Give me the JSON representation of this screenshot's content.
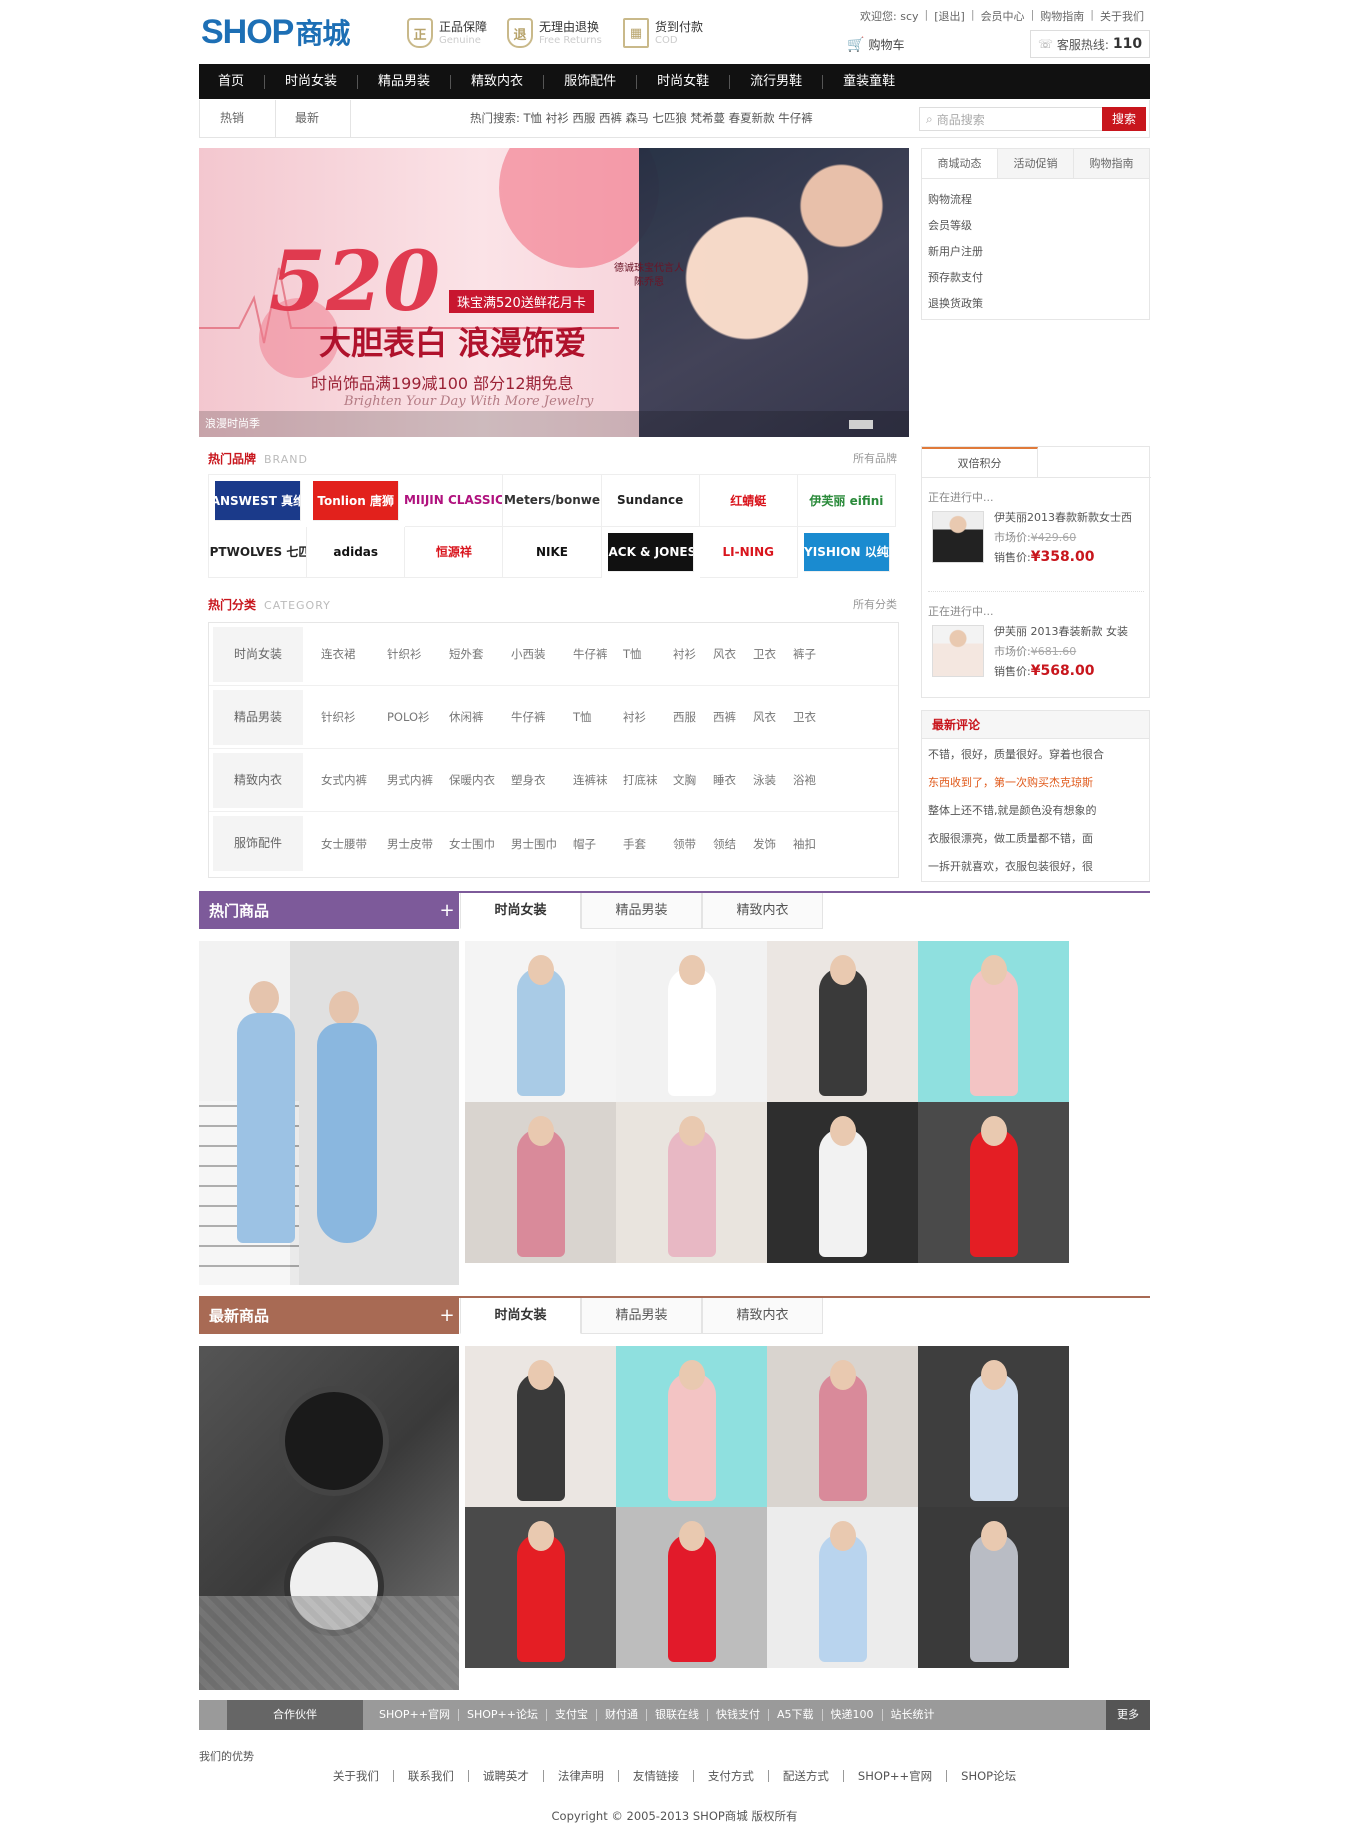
{
  "header": {
    "logo_en": "SHOP",
    "logo_cn": "商城",
    "badges": [
      {
        "title": "正品保障",
        "sub": "Genuine",
        "icon": "shield-icon"
      },
      {
        "title": "无理由退换",
        "sub": "Free Returns",
        "icon": "shield-icon"
      },
      {
        "title": "货到付款",
        "sub": "COD",
        "icon": "box-icon"
      }
    ],
    "welcome": "欢迎您: scy",
    "logout": "[退出]",
    "links": [
      "会员中心",
      "购物指南",
      "关于我们"
    ],
    "cart": "购物车",
    "hotline_label": "客服热线:",
    "hotline_num": "110"
  },
  "nav": [
    "首页",
    "时尚女装",
    "精品男装",
    "精致内衣",
    "服饰配件",
    "时尚女鞋",
    "流行男鞋",
    "童装童鞋"
  ],
  "subbar": {
    "tab_hot": "热销",
    "tab_new": "最新",
    "hot_keywords": "热门搜索: T恤 衬衫 西服 西裤 森马 七匹狼 梵希蔓 春夏新款 牛仔裤",
    "search_placeholder": "商品搜索",
    "search_button": "搜索"
  },
  "banner": {
    "num": "520",
    "tag": "珠宝满520送鲜花月卡",
    "main": "大胆表白 浪漫饰爱",
    "sub": "时尚饰品满199减100 部分12期免息",
    "slogan": "Brighten Your Day With More Jewelry",
    "brand": "德诚珠宝代言人\n陈乔恩",
    "caption": "浪漫时尚季"
  },
  "news": {
    "tabs": [
      "商城动态",
      "活动促销",
      "购物指南"
    ],
    "items": [
      "购物流程",
      "会员等级",
      "新用户注册",
      "预存款支付",
      "退换货政策"
    ]
  },
  "brands": {
    "title": "热门品牌",
    "en": "BRAND",
    "all": "所有品牌",
    "items": [
      {
        "name": "JEANSWEST 真维斯",
        "bg": "#1b3a8a",
        "fg": "#ffffff"
      },
      {
        "name": "Tonlion 唐狮",
        "bg": "#e2211c",
        "fg": "#ffffff"
      },
      {
        "name": "MIIJIN CLASSIC",
        "bg": "#ffffff",
        "fg": "#b0127e"
      },
      {
        "name": "Meters/bonwe",
        "bg": "#ffffff",
        "fg": "#333333"
      },
      {
        "name": "Sundance",
        "bg": "#ffffff",
        "fg": "#222222"
      },
      {
        "name": "红蜻蜓",
        "bg": "#ffffff",
        "fg": "#d9151d"
      },
      {
        "name": "伊芙丽 eifini",
        "bg": "#ffffff",
        "fg": "#2a8a3a"
      },
      {
        "name": "SEPTWOLVES 七匹狼",
        "bg": "#ffffff",
        "fg": "#222222"
      },
      {
        "name": "adidas",
        "bg": "#ffffff",
        "fg": "#111111"
      },
      {
        "name": "恒源祥",
        "bg": "#ffffff",
        "fg": "#d9151d"
      },
      {
        "name": "NIKE",
        "bg": "#ffffff",
        "fg": "#111111"
      },
      {
        "name": "JACK & JONES",
        "bg": "#111111",
        "fg": "#ffffff"
      },
      {
        "name": "LI-NING",
        "bg": "#ffffff",
        "fg": "#d9151d"
      },
      {
        "name": "YISHION 以纯",
        "bg": "#1a8bd0",
        "fg": "#ffffff"
      }
    ]
  },
  "category": {
    "title": "热门分类",
    "en": "CATEGORY",
    "all": "所有分类",
    "rows": [
      {
        "head": "时尚女装",
        "items": [
          "连衣裙",
          "针织衫",
          "短外套",
          "小西装",
          "牛仔裤",
          "T恤",
          "衬衫",
          "风衣",
          "卫衣",
          "裤子"
        ]
      },
      {
        "head": "精品男装",
        "items": [
          "针织衫",
          "POLO衫",
          "休闲裤",
          "牛仔裤",
          "T恤",
          "衬衫",
          "西服",
          "西裤",
          "风衣",
          "卫衣"
        ]
      },
      {
        "head": "精致内衣",
        "items": [
          "女式内裤",
          "男式内裤",
          "保暖内衣",
          "塑身衣",
          "连裤袜",
          "打底袜",
          "文胸",
          "睡衣",
          "泳装",
          "浴袍"
        ]
      },
      {
        "head": "服饰配件",
        "items": [
          "女士腰带",
          "男士皮带",
          "女士围巾",
          "男士围巾",
          "帽子",
          "手套",
          "领带",
          "领结",
          "发饰",
          "袖扣"
        ]
      }
    ]
  },
  "double_points": {
    "tab": "双倍积分",
    "items": [
      {
        "status": "正在进行中...",
        "name": "伊芙丽2013春款新款女士西",
        "market_label": "市场价:",
        "market": "¥429.60",
        "sale_label": "销售价:",
        "sale": "¥358.00"
      },
      {
        "status": "正在进行中...",
        "name": "伊芙丽 2013春装新款 女装",
        "market_label": "市场价:",
        "market": "¥681.60",
        "sale_label": "销售价:",
        "sale": "¥568.00"
      }
    ]
  },
  "reviews": {
    "title": "最新评论",
    "items": [
      {
        "text": "不错，很好，质量很好。穿着也很合",
        "hl": false
      },
      {
        "text": "东西收到了，第一次购买杰克琼斯",
        "hl": true
      },
      {
        "text": "整体上还不错,就是颜色没有想象的",
        "hl": false
      },
      {
        "text": "衣服很漂亮，做工质量都不错，面",
        "hl": false
      },
      {
        "text": "一拆开就喜欢，衣服包装很好，很",
        "hl": false
      }
    ]
  },
  "hot_products": {
    "title": "热门商品",
    "plus": "+",
    "color": "#7d5a9a",
    "tabs": [
      "时尚女装",
      "精品男装",
      "精致内衣"
    ]
  },
  "new_products": {
    "title": "最新商品",
    "plus": "+",
    "color": "#a86a54",
    "tabs": [
      "时尚女装",
      "精品男装",
      "精致内衣"
    ]
  },
  "footer": {
    "partner_label": "合作伙伴",
    "partners": [
      "SHOP++官网",
      "SHOP++论坛",
      "支付宝",
      "财付通",
      "银联在线",
      "快钱支付",
      "A5下载",
      "快递100",
      "站长统计"
    ],
    "more": "更多",
    "advantage": "我们的优势",
    "links": [
      "关于我们",
      "联系我们",
      "诚聘英才",
      "法律声明",
      "友情链接",
      "支付方式",
      "配送方式",
      "SHOP++官网",
      "SHOP论坛"
    ],
    "copyright": "Copyright © 2005-2013 SHOP商城 版权所有"
  }
}
